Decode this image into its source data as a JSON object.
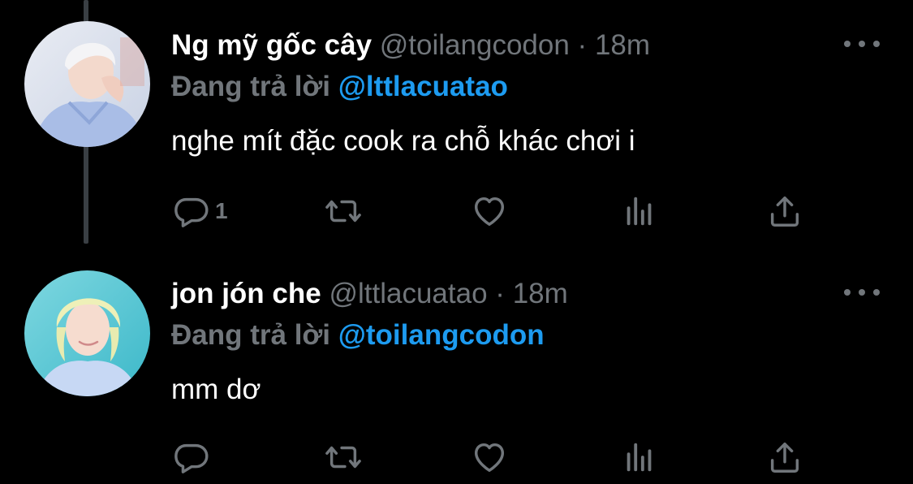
{
  "colors": {
    "background": "#000000",
    "display_name": "#ffffff",
    "muted": "#71767b",
    "link": "#1d9bf0",
    "thread_line": "#3a3f44"
  },
  "tweets": [
    {
      "display_name": "Ng mỹ gốc cây",
      "handle": "@toilangcodon",
      "separator": "·",
      "time": "18m",
      "reply_prefix": "Đang trả lời",
      "reply_to": "@lttlacuatao",
      "text": "nghe mít đặc cook ra chỗ khác chơi i",
      "reply_count": "1",
      "icons": {
        "more": "more-horizontal-icon",
        "reply": "reply-bubble-icon",
        "retweet": "retweet-icon",
        "like": "heart-icon",
        "views": "analytics-bars-icon",
        "share": "share-upload-icon"
      }
    },
    {
      "display_name": "jon jón che",
      "handle": "@lttlacuatao",
      "separator": "·",
      "time": "18m",
      "reply_prefix": "Đang trả lời",
      "reply_to": "@toilangcodon",
      "text": "mm dơ",
      "reply_count": "",
      "icons": {
        "more": "more-horizontal-icon",
        "reply": "reply-bubble-icon",
        "retweet": "retweet-icon",
        "like": "heart-icon",
        "views": "analytics-bars-icon",
        "share": "share-upload-icon"
      }
    }
  ]
}
